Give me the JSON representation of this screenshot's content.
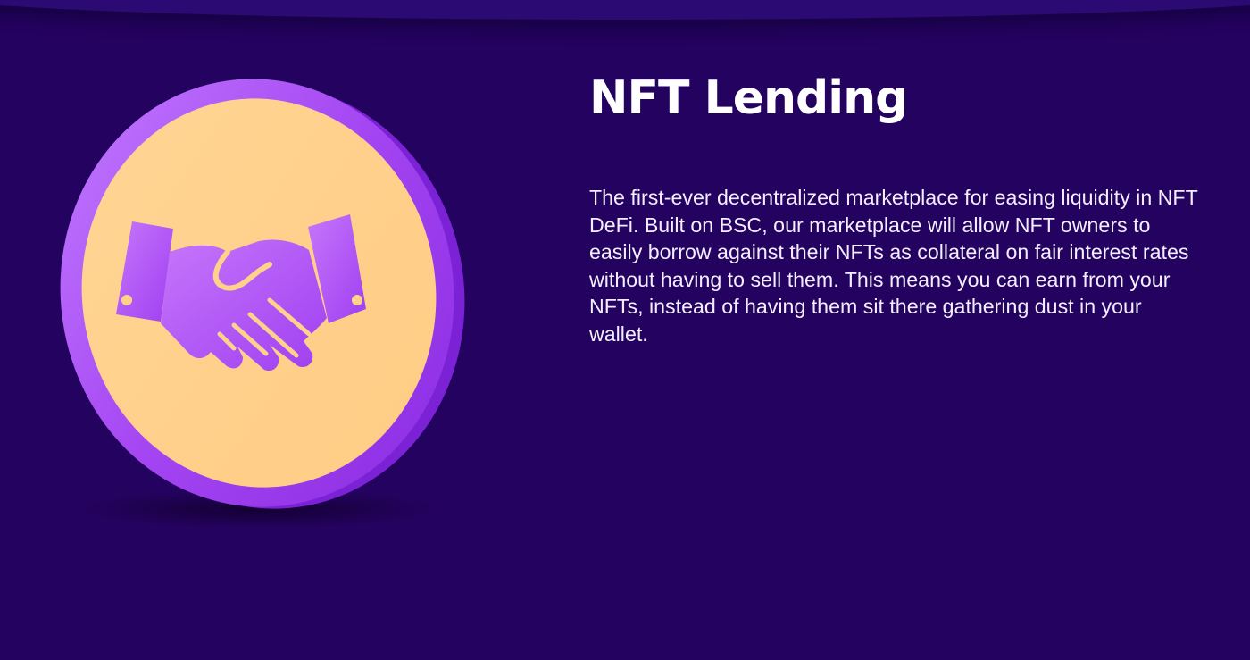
{
  "section": {
    "title": "NFT Lending",
    "description": "The first-ever decentralized marketplace for easing liquidity in NFT DeFi. Built on BSC, our marketplace will allow NFT owners to easily borrow against their NFTs as collateral on fair interest rates without having to sell them. This means you can earn from your NFTs, instead of having them sit there gathering dust in your wallet."
  },
  "icons": {
    "coin": "handshake-coin-icon",
    "handshake": "handshake-icon"
  },
  "colors": {
    "background": "#24025f",
    "coin_face": "#ffd28c",
    "coin_rim": "#a94ef5",
    "handshake": "#b45cf6",
    "text": "#ffffff"
  }
}
